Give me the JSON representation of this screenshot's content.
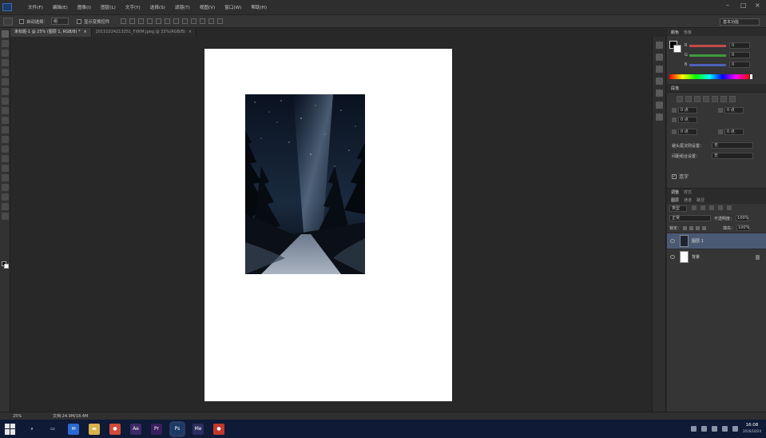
{
  "menubar": {
    "items": [
      "文件(F)",
      "编辑(E)",
      "图像(I)",
      "图层(L)",
      "文字(Y)",
      "选择(S)",
      "滤镜(T)",
      "视图(V)",
      "窗口(W)",
      "帮助(H)"
    ]
  },
  "options": {
    "auto_select_label": "自动选择：",
    "auto_select_value": "组",
    "transform_label": "显示变换控件",
    "workspace": "基本功能"
  },
  "tabs": [
    {
      "label": "未标题-1 @ 25% (图层 1, RGB/8) *",
      "close": "×"
    },
    {
      "label": "20151024213251_FXKM.jpeg @ 33%(RGB/8)",
      "close": "×"
    }
  ],
  "color_panel": {
    "tabs": [
      "颜色",
      "色板"
    ],
    "r_label": "R",
    "g_label": "G",
    "b_label": "B",
    "r": "0",
    "g": "0",
    "b": "0",
    "colors": {
      "r_track": "#c24b4b",
      "g_track": "#3f9a3f",
      "b_track": "#4a63b8"
    }
  },
  "paragraph_panel": {
    "tab": "段落",
    "indent_left": "0 点",
    "indent_right": "0 点",
    "indent_first": "0 点",
    "space_before": "0 点",
    "space_after": "0 点",
    "kinsoku_label": "避头尾法则设置：",
    "kinsoku_value": "无",
    "mojikumi_label": "间距组合设置：",
    "mojikumi_value": "无",
    "hyphen_label": "连字",
    "hyphen_check": "✓"
  },
  "layers_panel": {
    "adjust_tabs": [
      "调整",
      "样式"
    ],
    "tabs": [
      "图层",
      "通道",
      "路径"
    ],
    "kind": "类型",
    "blend_mode": "正常",
    "opacity_label": "不透明度：",
    "opacity": "100%",
    "lock_label": "锁定：",
    "fill_label": "填充：",
    "fill": "100%",
    "layers": [
      {
        "name": "图层 1",
        "selected": true
      },
      {
        "name": "背景",
        "selected": false
      }
    ]
  },
  "statusbar": {
    "zoom": "25%",
    "doc": "文档:24.9M/18.4M"
  },
  "taskbar": {
    "apps": [
      {
        "name": "search-icon",
        "glyph": "⌕",
        "color": "#0e1a36"
      },
      {
        "name": "task-view-icon",
        "glyph": "▭",
        "color": "#0e1a36"
      },
      {
        "name": "mail-icon",
        "glyph": "✉",
        "color": "#2a6ad0"
      },
      {
        "name": "folder-icon",
        "glyph": "▬",
        "color": "#d8b24a"
      },
      {
        "name": "chrome-icon",
        "glyph": "●",
        "color": "#cf4b3a"
      },
      {
        "name": "after-effects-icon",
        "glyph": "Ae",
        "color": "#3d2a66"
      },
      {
        "name": "premiere-icon",
        "glyph": "Pr",
        "color": "#3a1f5c"
      },
      {
        "name": "photoshop-icon",
        "glyph": "Ps",
        "color": "#1a3a66"
      },
      {
        "name": "media-encoder-icon",
        "glyph": "Me",
        "color": "#2c2c5e"
      },
      {
        "name": "recorder-icon",
        "glyph": "●",
        "color": "#c0392b"
      }
    ],
    "time": "16:08",
    "date": "2016/10/24"
  }
}
